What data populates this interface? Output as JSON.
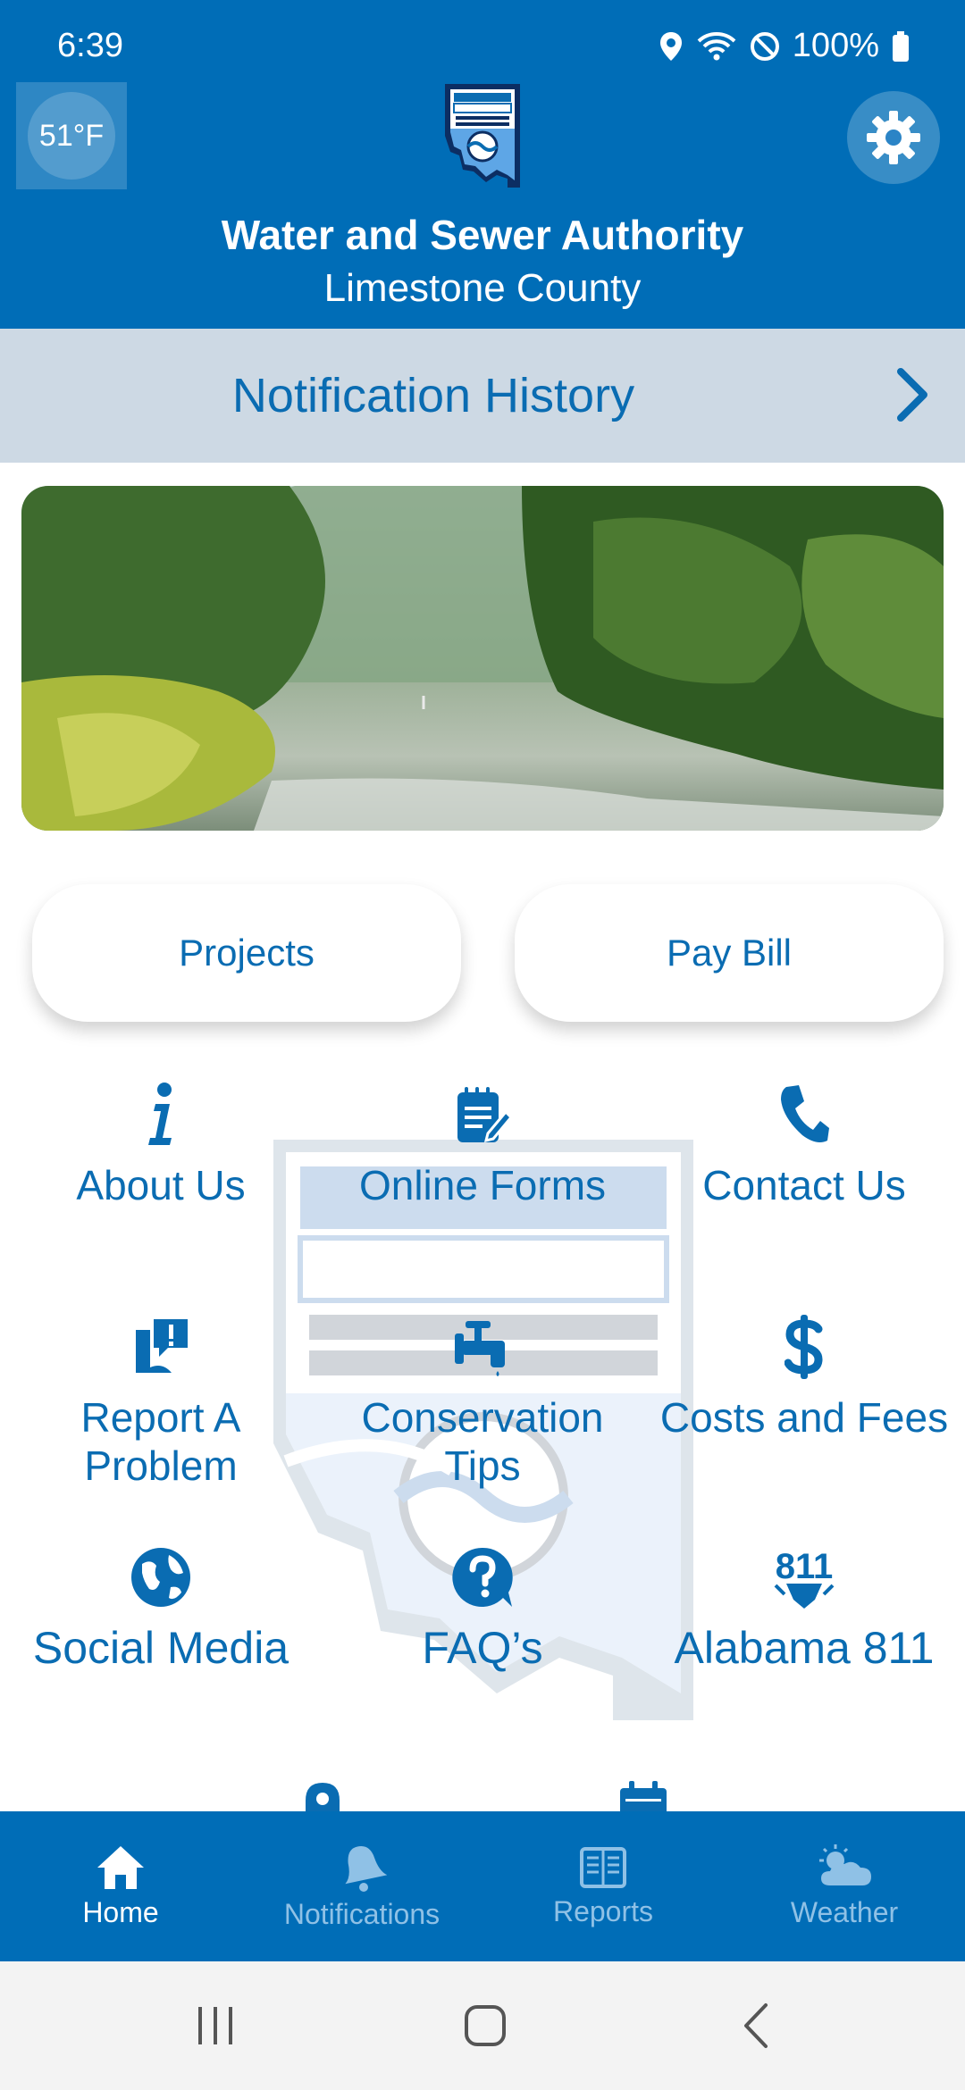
{
  "status": {
    "time": "6:39",
    "battery": "100%"
  },
  "header": {
    "temperature": "51°F",
    "org_name": "Water and Sewer Authority",
    "county": "Limestone County",
    "logo_text": "LIMESTONE COUNTY WATER AND SEWER AUTHORITY"
  },
  "notification_bar": {
    "label": "Notification History"
  },
  "buttons": {
    "projects": "Projects",
    "pay_bill": "Pay Bill"
  },
  "grid": [
    {
      "label": "About Us",
      "icon": "info-icon"
    },
    {
      "label": "Online Forms",
      "icon": "form-icon"
    },
    {
      "label": "Contact Us",
      "icon": "phone-icon"
    },
    {
      "label": "Report A Problem",
      "icon": "report-icon"
    },
    {
      "label": "Conservation Tips",
      "icon": "faucet-icon"
    },
    {
      "label": "Costs and Fees",
      "icon": "dollar-icon"
    },
    {
      "label": "Social Media",
      "icon": "globe-icon"
    },
    {
      "label": "FAQ’s",
      "icon": "question-icon"
    },
    {
      "label": "Alabama 811",
      "icon": "alabama-811-icon"
    }
  ],
  "grid_partial_icons": [
    "map-pin-icon",
    "calendar-icon"
  ],
  "bottom_nav": [
    {
      "label": "Home",
      "icon": "home-icon",
      "active": true
    },
    {
      "label": "Notifications",
      "icon": "bell-icon",
      "active": false
    },
    {
      "label": "Reports",
      "icon": "newspaper-icon",
      "active": false
    },
    {
      "label": "Weather",
      "icon": "weather-icon",
      "active": false
    }
  ],
  "colors": {
    "primary": "#006db7",
    "accent_text": "#0a6cb2",
    "notif_bg": "#cdd9e4",
    "nav_inactive": "#8fc1e6"
  }
}
